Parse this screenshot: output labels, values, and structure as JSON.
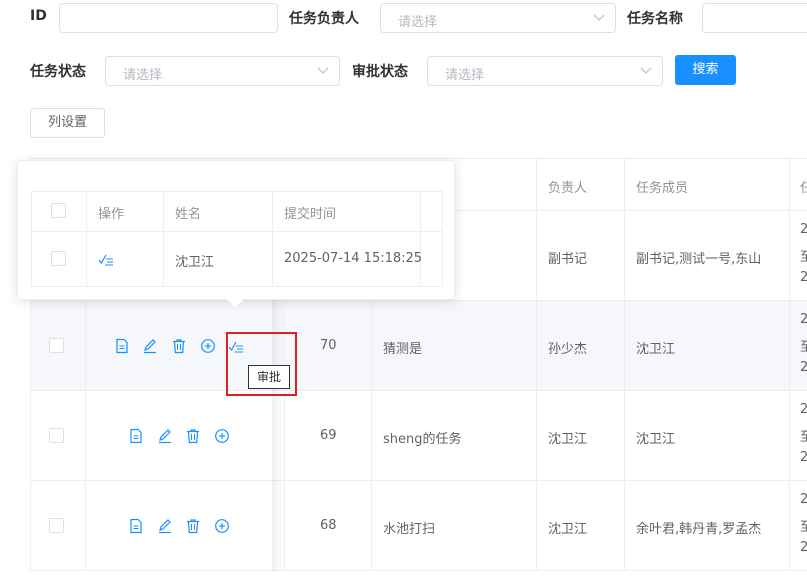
{
  "filters": {
    "id_label": "ID",
    "owner_label": "任务负责人",
    "owner_placeholder": "请选择",
    "task_name_label": "任务名称",
    "status_label": "任务状态",
    "status_placeholder": "请选择",
    "approval_label": "审批状态",
    "approval_placeholder": "请选择",
    "search_button": "搜索",
    "column_settings_button": "列设置"
  },
  "table": {
    "headers": {
      "owner": "负责人",
      "members": "任务成员",
      "partial": "任"
    },
    "rows": [
      {
        "id": "",
        "name": "",
        "owner": "副书记",
        "members": "副书记,测试一号,东山",
        "tail": [
          "2",
          "至",
          "2"
        ]
      },
      {
        "id": "70",
        "name": "猜测是",
        "owner": "孙少杰",
        "members": "沈卫江",
        "tail": [
          "2",
          "至",
          "2"
        ]
      },
      {
        "id": "69",
        "name": "sheng的任务",
        "owner": "沈卫江",
        "members": "沈卫江",
        "tail": [
          "2",
          "至",
          "2"
        ]
      },
      {
        "id": "68",
        "name": "水池打扫",
        "owner": "沈卫江",
        "members": "余叶君,韩丹青,罗孟杰",
        "tail": [
          "2",
          "至",
          "2"
        ]
      }
    ]
  },
  "popover": {
    "headers": {
      "action": "操作",
      "name": "姓名",
      "submit_time": "提交时间"
    },
    "row": {
      "name": "沈卫江",
      "submit_time": "2025-07-14 15:18:25"
    }
  },
  "tooltip": {
    "text": "审批"
  },
  "colors": {
    "primary": "#1890ff",
    "highlight_box": "#e02020",
    "row_hover": "#f5f7fa"
  }
}
